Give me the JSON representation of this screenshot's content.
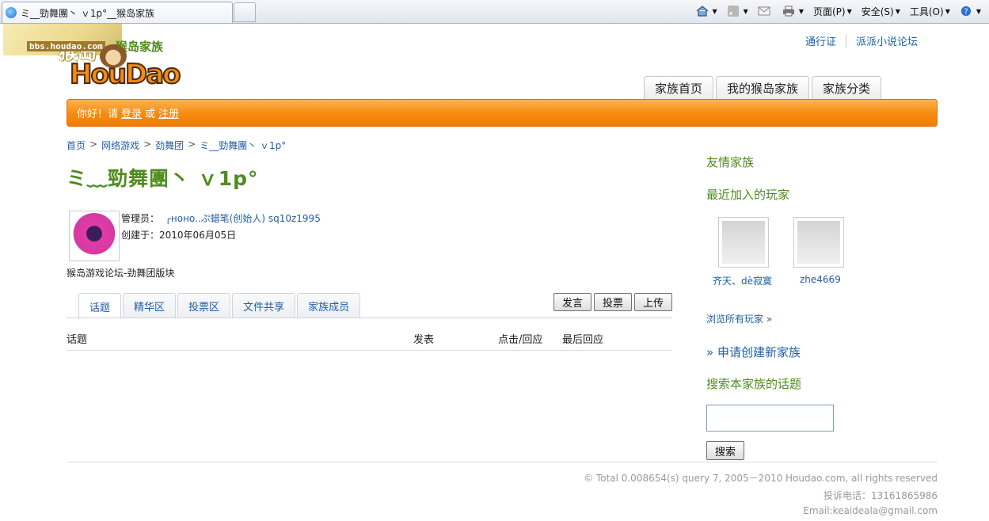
{
  "browser": {
    "tab_title": "ミ__勁舞團丶 ｖ1p°__猴岛家族",
    "toolbar": {
      "page_label": "页面(P)",
      "safety_label": "安全(S)",
      "tools_label": "工具(O)"
    }
  },
  "logo": {
    "bbs_big": "猴岛",
    "bbs_url": "bbs.houdao.com",
    "cn": "猴岛家族",
    "main": "HouDao"
  },
  "toplinks": [
    "通行证",
    "派派小说论坛"
  ],
  "nav_tabs": [
    "家族首页",
    "我的猴岛家族",
    "家族分类"
  ],
  "welcome": {
    "greeting": "你好！请",
    "login": "登录",
    "or": "或",
    "register": "注册"
  },
  "breadcrumb": [
    "首页",
    "网络游戏",
    "劲舞团",
    "ミ__勁舞團丶 ｖ1p°"
  ],
  "breadcrumb_sep": ">",
  "family": {
    "title": "ミ﹏勁舞團丶 ｖ1p°",
    "admin_label": "管理员：",
    "admin_value": "╭нoнo..ぷ蜡笔(创始人) sq10z1995",
    "created_label": "创建于：",
    "created_value": "2010年06月05日",
    "description": "猴岛游戏论坛-劲舞团版块"
  },
  "content_tabs": [
    "话题",
    "精华区",
    "投票区",
    "文件共享",
    "家族成员"
  ],
  "actions": [
    "发言",
    "投票",
    "上传"
  ],
  "table_headers": {
    "topic": "话题",
    "author": "发表",
    "clicks": "点击/回应",
    "last": "最后回应"
  },
  "sidebar": {
    "friends": "友情家族",
    "recent_members": "最近加入的玩家",
    "members": [
      {
        "name": "齐天、dè寂寞"
      },
      {
        "name": "zhe4669"
      }
    ],
    "browse_all": "浏览所有玩家 »",
    "apply": "» 申请创建新家族",
    "search_title": "搜索本家族的话题",
    "search_button": "搜索"
  },
  "footer": {
    "copyright": "© Total 0.008654(s) query 7, 2005－2010 Houdao.com, all rights reserved",
    "phone": "投诉电话：13161865986",
    "email": "Email:keaideala@gmail.com"
  }
}
